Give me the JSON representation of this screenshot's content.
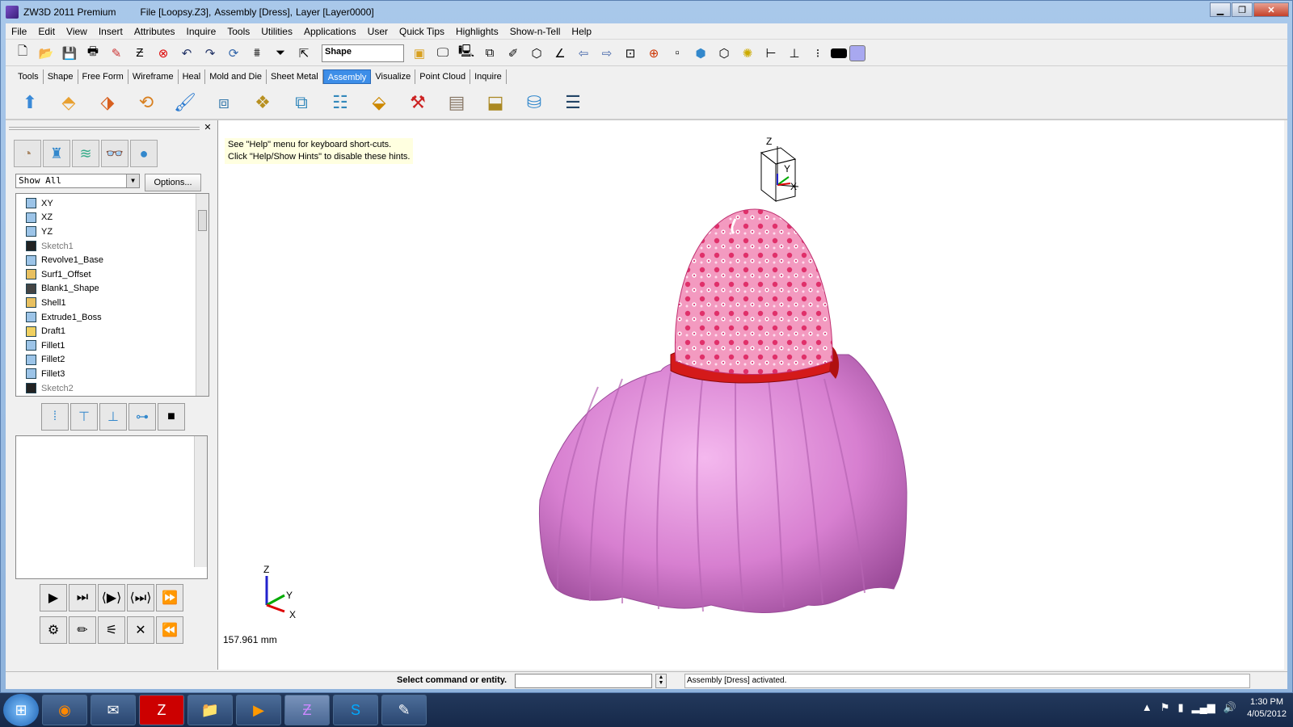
{
  "window": {
    "app": "ZW3D 2011 Premium",
    "file": "File [Loopsy.Z3],",
    "assembly": "Assembly [Dress],",
    "layer": "Layer [Layer0000]"
  },
  "menu": [
    "File",
    "Edit",
    "View",
    "Insert",
    "Attributes",
    "Inquire",
    "Tools",
    "Utilities",
    "Applications",
    "User",
    "Quick Tips",
    "Highlights",
    "Show-n-Tell",
    "Help"
  ],
  "toolbar": {
    "shape_field": "Shape"
  },
  "tabs": [
    "Tools",
    "Shape",
    "Free Form",
    "Wireframe",
    "Heal",
    "Mold and Die",
    "Sheet Metal",
    "Assembly",
    "Visualize",
    "Point Cloud",
    "Inquire"
  ],
  "active_tab": "Assembly",
  "panel": {
    "filter": "Show All",
    "options_label": "Options...",
    "tree": [
      "XY",
      "XZ",
      "YZ",
      "Sketch1",
      "Revolve1_Base",
      "Surf1_Offset",
      "Blank1_Shape",
      "Shell1",
      "Extrude1_Boss",
      "Draft1",
      "Fillet1",
      "Fillet2",
      "Fillet3",
      "Sketch2"
    ]
  },
  "viewport": {
    "hint_line1": "See \"Help\" menu for keyboard short-cuts.",
    "hint_line2": "Click \"Help/Show Hints\" to disable these hints.",
    "units": "157.961 mm",
    "axis_z": "Z",
    "axis_y": "Y",
    "axis_x": "X"
  },
  "status": {
    "prompt": "Select command or entity.",
    "message": "Assembly [Dress] activated."
  },
  "clock": {
    "time": "1:30 PM",
    "date": "4/05/2012"
  },
  "colors": {
    "dress": "#d77fd0",
    "bodice": "#f06a9a",
    "sash": "#d41a1a",
    "tab_active": "#3d8ee8"
  }
}
